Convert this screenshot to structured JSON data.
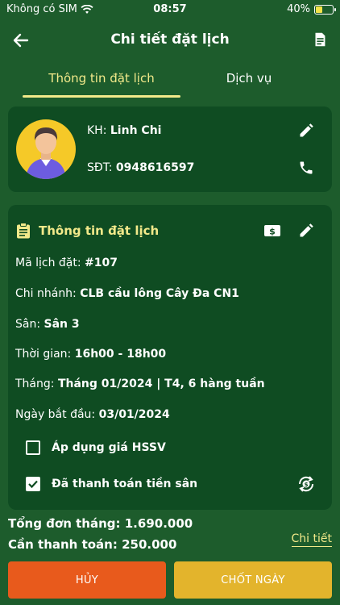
{
  "status_bar": {
    "carrier": "Không có SIM",
    "time": "08:57",
    "battery": "40%",
    "battery_level": 0.4
  },
  "nav": {
    "title": "Chi tiết đặt lịch",
    "back_icon": "arrow-left-icon",
    "action_icon": "clipboard-icon"
  },
  "tabs": [
    {
      "label": "Thông tin đặt lịch",
      "active": true
    },
    {
      "label": "Dịch vụ",
      "active": false
    }
  ],
  "customer": {
    "name_label": "KH:",
    "name": "Linh Chi",
    "phone_label": "SĐT:",
    "phone": "0948616597"
  },
  "booking": {
    "section_title": "Thông tin đặt lịch",
    "rows": [
      {
        "label": "Mã lịch đặt:",
        "value": "#107"
      },
      {
        "label": "Chi nhánh:",
        "value": "CLB cầu lông Cây Đa CN1"
      },
      {
        "label": "Sân:",
        "value": "Sân 3"
      },
      {
        "label": "Thời gian:",
        "value": "16h00 - 18h00"
      },
      {
        "label": "Tháng:",
        "value": "Tháng 01/2024 | T4, 6 hàng tuần"
      },
      {
        "label": "Ngày bắt đầu:",
        "value": "03/01/2024"
      }
    ],
    "options": [
      {
        "label": "Áp dụng giá HSSV",
        "checked": false
      },
      {
        "label": "Đã thanh toán tiền sân",
        "checked": true
      }
    ]
  },
  "footer": {
    "total_label": "Tổng đơn tháng:",
    "total_value": "1.690.000",
    "due_label": "Cần thanh toán:",
    "due_value": "250.000",
    "detail_link": "Chi tiết",
    "cancel_button": "HỦY",
    "confirm_button": "CHỐT NGÀY"
  },
  "colors": {
    "background": "#1d5c2c",
    "card": "#0f4c22",
    "accent_yellow": "#f2e98a",
    "cancel": "#e85a1c",
    "confirm": "#e3b42c"
  }
}
